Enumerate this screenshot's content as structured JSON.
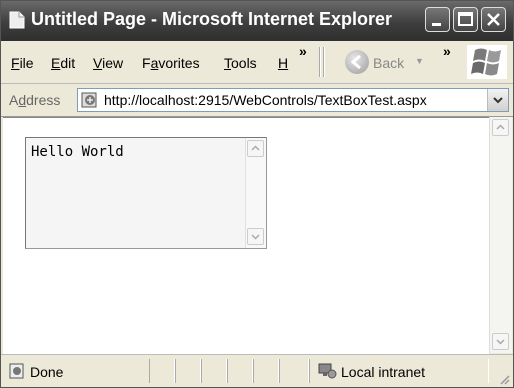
{
  "window": {
    "title": "Untitled Page - Microsoft Internet Explorer"
  },
  "menu": {
    "items": [
      {
        "label": "File",
        "accel": "F",
        "rest": "ile"
      },
      {
        "label": "Edit",
        "accel": "E",
        "rest": "dit"
      },
      {
        "label": "View",
        "accel": "V",
        "rest": "iew"
      },
      {
        "label": "Favorites",
        "pre": "F",
        "accel": "a",
        "rest": "vorites"
      },
      {
        "label": "Tools",
        "accel": "T",
        "rest": "ools"
      },
      {
        "label": "H",
        "accel": "H",
        "rest": ""
      }
    ],
    "overflow_symbol": "»"
  },
  "toolbar": {
    "back_label": "Back",
    "back_dropdown": "▼",
    "overflow_symbol": "»"
  },
  "address": {
    "label_accel": "d",
    "label_pre": "A",
    "label_rest": "dress",
    "url": "http://localhost:2915/WebControls/TextBoxTest.aspx"
  },
  "page": {
    "textbox_value": "Hello World"
  },
  "status": {
    "text": "Done",
    "zone": "Local intranet"
  },
  "colors": {
    "titlebar": "#3e3e3e",
    "chrome": "#ECE9D8",
    "content": "#FFFFFF"
  }
}
